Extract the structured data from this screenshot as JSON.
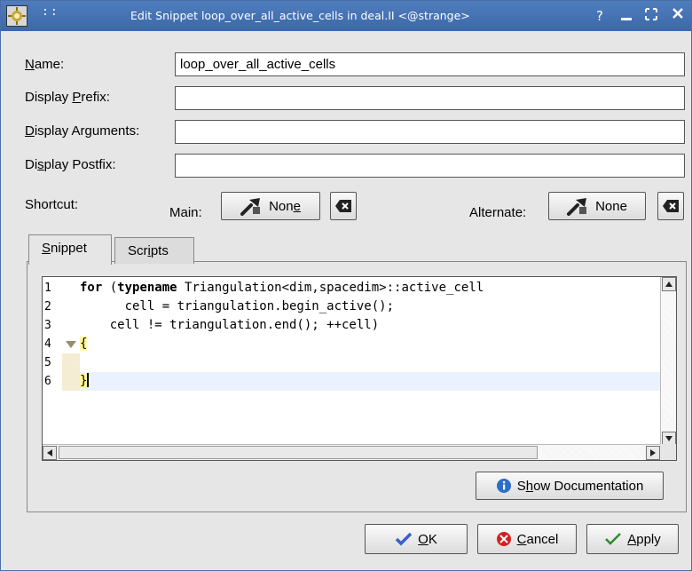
{
  "window": {
    "title": "Edit Snippet loop_over_all_active_cells in deal.II <@strange>",
    "grip": "::",
    "help": "?",
    "minimize": "_",
    "maximize": "[ ]",
    "close": "x"
  },
  "form": {
    "name_label_prefix": "",
    "name_label_mn": "N",
    "name_label_rest": "ame:",
    "name_value": "loop_over_all_active_cells",
    "prefix_label_a": "Display ",
    "prefix_label_mn": "P",
    "prefix_label_b": "refix:",
    "prefix_value": "",
    "args_label_mn": "D",
    "args_label_b": "isplay Arguments:",
    "args_value": "",
    "postfix_label_a": "Di",
    "postfix_label_mn": "s",
    "postfix_label_b": "play Postfix:",
    "postfix_value": ""
  },
  "shortcut": {
    "label": "Shortcut:",
    "main_label": "Main:",
    "main_value_a": "Non",
    "main_value_mn": "e",
    "alternate_label": "Alternate:",
    "alternate_value": "None"
  },
  "tabs": {
    "snippet_mn": "S",
    "snippet_rest": "nippet",
    "scripts_a": "Scr",
    "scripts_mn": "i",
    "scripts_b": "pts"
  },
  "editor": {
    "line_numbers": [
      "1",
      "2",
      "3",
      "4",
      "5",
      "6"
    ],
    "line1_kw1": "for",
    "line1_mid": " (",
    "line1_kw2": "typename",
    "line1_rest": " Triangulation<dim,spacedim>::active_cell",
    "line2": "      cell = triangulation.begin_active();",
    "line3": "    cell != triangulation.end(); ++cell)",
    "line4": "{",
    "line5": "",
    "line6": "}"
  },
  "buttons": {
    "show_doc_a": "S",
    "show_doc_mn": "h",
    "show_doc_b": "ow Documentation",
    "ok_mn": "O",
    "ok_rest": "K",
    "cancel_mn": "C",
    "cancel_rest": "ancel",
    "apply_mn": "A",
    "apply_rest": "pply"
  },
  "colors": {
    "titlebar": "#4a78b8",
    "ok_icon": "#3a5fcd",
    "cancel_icon": "#d42020",
    "apply_icon": "#2e8b2e",
    "info_icon": "#2a6fc9"
  }
}
